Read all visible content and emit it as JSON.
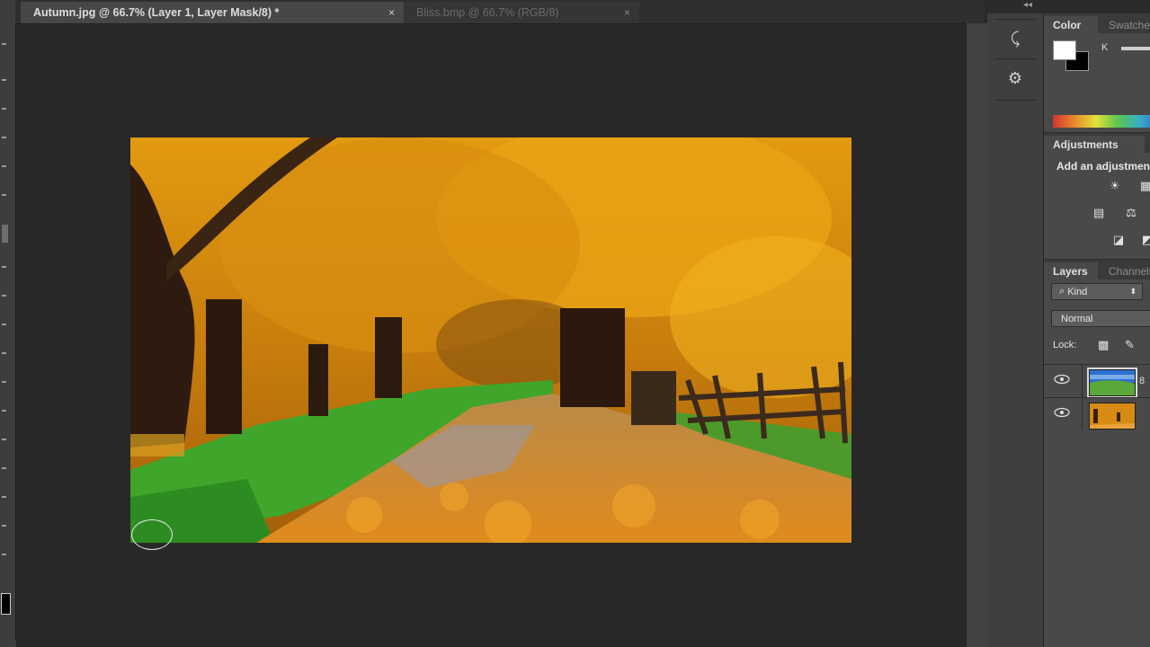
{
  "document_tabs": [
    {
      "title": "Autumn.jpg @ 66.7% (Layer 1, Layer Mask/8) *",
      "close": "×",
      "active": true
    },
    {
      "title": "Bliss.bmp @ 66.7% (RGB/8)",
      "close": "×",
      "active": false
    }
  ],
  "panel_collapse": "◂◂",
  "icon_column": [
    {
      "icon": "history-brush-icon",
      "glyph": "⤹"
    },
    {
      "icon": "properties-icon",
      "glyph": "⚙"
    }
  ],
  "color_panel": {
    "tabs": [
      "Color",
      "Swatches"
    ],
    "foreground": "#ffffff",
    "background": "#000000",
    "slider_label": "K"
  },
  "adjustments_panel": {
    "tab": "Adjustments",
    "title": "Add an adjustment",
    "icons": [
      "brightness-icon",
      "levels-icon",
      "curves-icon",
      "balance-icon",
      "exposure-icon",
      "vibrance-icon"
    ]
  },
  "layers_panel": {
    "tabs": [
      "Layers",
      "Channels"
    ],
    "filter_kind": "Kind",
    "blend_mode": "Normal",
    "lock_label": "Lock:",
    "layers": [
      {
        "thumbnail": "bliss",
        "visible": true,
        "selected": true
      },
      {
        "thumbnail": "autumn",
        "visible": true,
        "selected": false
      }
    ]
  }
}
